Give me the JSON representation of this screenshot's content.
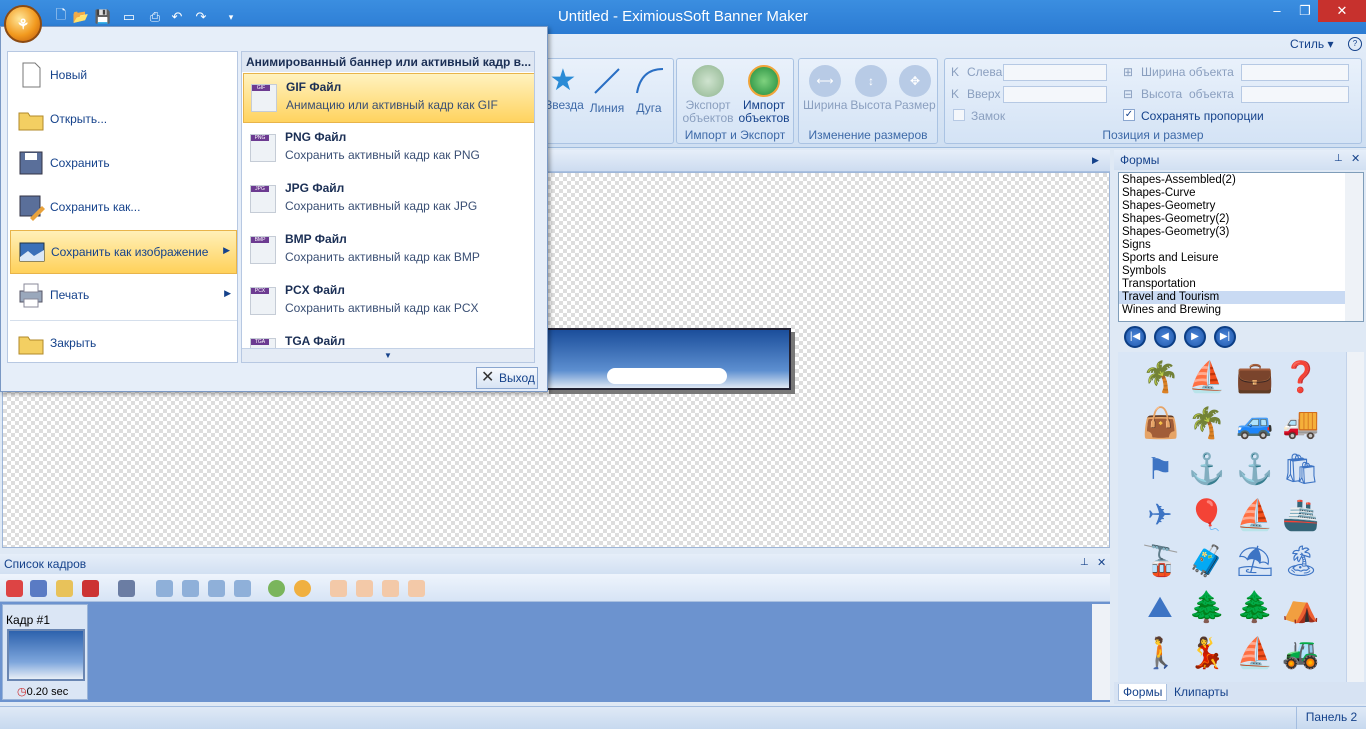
{
  "window": {
    "title": "Untitled - EximiousSoft Banner Maker"
  },
  "ribbon": {
    "style_label": "Стиль",
    "shape_buttons": [
      {
        "label": "Звезда"
      },
      {
        "label": "Линия"
      },
      {
        "label": "Дуга"
      }
    ],
    "import_export": {
      "export_label": "Экспорт\nобъектов",
      "import_label": "Импорт\nобъектов",
      "group_label": "Импорт и Экспорт"
    },
    "resize": {
      "width_label": "Ширина",
      "height_label": "Высота",
      "size_label": "Размер",
      "group_label": "Изменение размеров"
    },
    "position": {
      "left_label": "Слева",
      "top_label": "Вверх",
      "lock_label": "Замок",
      "width_label": "Ширина",
      "width_obj": "объекта",
      "height_label": "Высота",
      "height_obj": "объекта",
      "keep_ratio_label": "Сохранять пропорции",
      "group_label": "Позиция и размер"
    }
  },
  "app_menu": {
    "items": [
      {
        "label": "Новый"
      },
      {
        "label": "Открыть..."
      },
      {
        "label": "Сохранить"
      },
      {
        "label": "Сохранить как..."
      },
      {
        "label": "Сохранить как изображение"
      },
      {
        "label": "Печать"
      },
      {
        "label": "Закрыть"
      }
    ],
    "submenu_title": "Анимированный баннер или активный кадр в...",
    "submenu": [
      {
        "tag": "GIF",
        "title": "GIF Файл",
        "desc": "Анимацию или активный кадр как GIF"
      },
      {
        "tag": "PNG",
        "title": "PNG Файл",
        "desc": "Сохранить активный кадр как PNG"
      },
      {
        "tag": "JPG",
        "title": "JPG Файл",
        "desc": "Сохранить активный кадр как JPG"
      },
      {
        "tag": "BMP",
        "title": "BMP Файл",
        "desc": "Сохранить активный кадр как BMP"
      },
      {
        "tag": "PCX",
        "title": "PCX Файл",
        "desc": "Сохранить активный кадр как PCX"
      },
      {
        "tag": "TGA",
        "title": "TGA Файл",
        "desc": ""
      }
    ],
    "exit_label": "Выход"
  },
  "frames_panel": {
    "title": "Список кадров",
    "frame": {
      "label": "Кадр #1",
      "duration": "0.20 sec"
    }
  },
  "forms_panel": {
    "title": "Формы",
    "list": [
      "Shapes-Assembled(2)",
      "Shapes-Curve",
      "Shapes-Geometry",
      "Shapes-Geometry(2)",
      "Shapes-Geometry(3)",
      "Signs",
      "Sports and Leisure",
      "Symbols",
      "Transportation",
      "Travel and Tourism",
      "Wines and Brewing"
    ],
    "selected": "Travel and Tourism",
    "tabs": [
      {
        "label": "Формы"
      },
      {
        "label": "Клипарты"
      }
    ]
  },
  "status": {
    "panel_label": "Панель 2"
  },
  "colors": {
    "accent": "#2b7bd3",
    "menu_highlight": "#ffd15a",
    "frames_bg": "#6c93cf"
  }
}
